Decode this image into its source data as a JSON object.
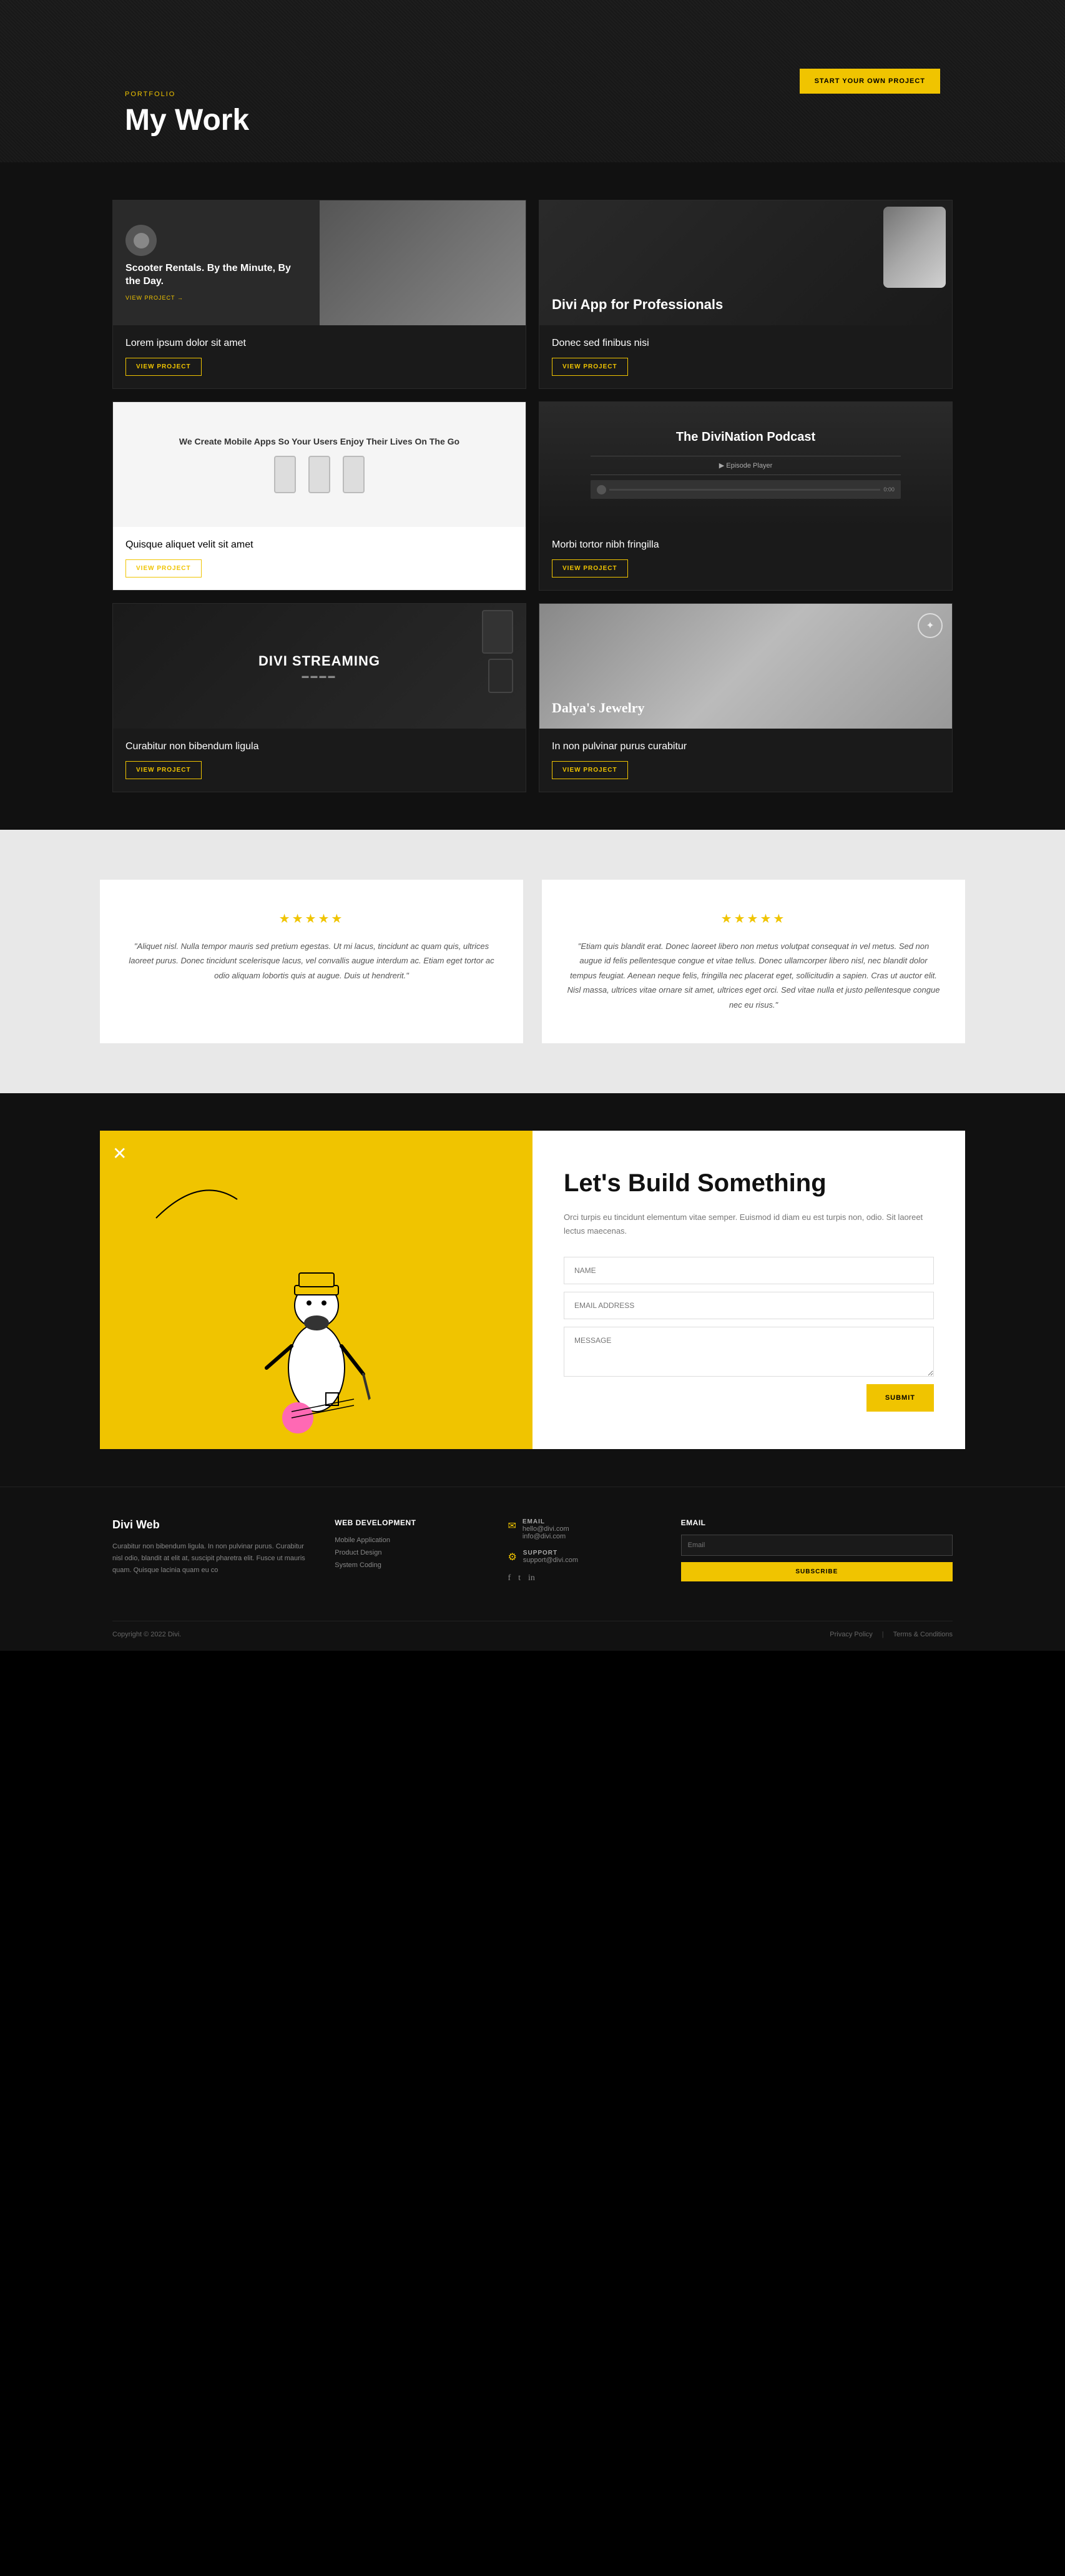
{
  "hero": {
    "label": "PORTFOLIO",
    "title": "My Work",
    "cta_button": "START YOUR OWN PROJECT"
  },
  "projects": [
    {
      "id": "scooter",
      "thumb_title": "Scooter Rentals. By the Minute, By the Day.",
      "description": "Lorem ipsum dolor sit amet",
      "btn_label": "VIEW PROJECT",
      "theme": "dark"
    },
    {
      "id": "divi-app",
      "thumb_title": "Divi App for Professionals",
      "description": "Donec sed finibus nisi",
      "btn_label": "VIEW PROJECT",
      "theme": "dark"
    },
    {
      "id": "mobile",
      "thumb_title": "We Create Mobile Apps So Your Users Enjoy Their Lives On The Go",
      "description": "Quisque aliquet velit sit amet",
      "btn_label": "VIEW PROJECT",
      "theme": "light"
    },
    {
      "id": "divination",
      "thumb_title": "The DiviNation Podcast",
      "description": "Morbi tortor nibh fringilla",
      "btn_label": "VIEW PROJECT",
      "theme": "dark"
    },
    {
      "id": "streaming",
      "thumb_title": "DIVI STREAMING",
      "description": "Curabitur non bibendum ligula",
      "btn_label": "VIEW PROJECT",
      "theme": "dark"
    },
    {
      "id": "jewelry",
      "thumb_title": "Dalya's Jewelry",
      "description": "In non pulvinar purus curabitur",
      "btn_label": "VIEW PROJECT",
      "theme": "dark"
    }
  ],
  "testimonials": [
    {
      "stars": "★★★★★",
      "text": "\"Aliquet nisl. Nulla tempor mauris sed pretium egestas. Ut mi lacus, tincidunt ac quam quis, ultrices laoreet purus. Donec tincidunt scelerisque lacus, vel convallis augue interdum ac. Etiam eget tortor ac odio aliquam lobortis quis at augue. Duis ut hendrerit.\""
    },
    {
      "stars": "★★★★★",
      "text": "\"Etiam quis blandit erat. Donec laoreet libero non metus volutpat consequat in vel metus. Sed non augue id felis pellentesque congue et vitae tellus. Donec ullamcorper libero nisl, nec blandit dolor tempus feugiat. Aenean neque felis, fringilla nec placerat eget, sollicitudin a sapien. Cras ut auctor elit. Nisl massa, ultrices vitae ornare sit amet, ultrices eget orci. Sed vitae nulla et justo pellentesque congue nec eu risus.\""
    }
  ],
  "cta": {
    "title": "Let's Build Something",
    "description": "Orci turpis eu tincidunt elementum vitae semper. Euismod id diam eu est turpis non, odio. Sit laoreet lectus maecenas.",
    "form": {
      "name_placeholder": "NAME",
      "email_placeholder": "EMAIL ADDRESS",
      "message_placeholder": "MESSAGE",
      "submit_label": "SUBMIT"
    },
    "deco_x": "✕"
  },
  "footer": {
    "brand_name": "Divi Web",
    "brand_desc": "Curabitur non bibendum ligula. In non pulvinar purus. Curabitur nisl odio, blandit at elit at, suscipit pharetra elit. Fusce ut mauris quam. Quisque lacinia quam eu co",
    "nav_col": {
      "title": "Web Development",
      "links": [
        "Mobile Application",
        "Product Design",
        "System Coding"
      ]
    },
    "contact": {
      "email_label": "EMAIL",
      "email_values": [
        "hello@divi.com",
        "info@divi.com"
      ],
      "support_label": "SUPPORT",
      "support_value": "support@divi.com"
    },
    "newsletter": {
      "label": "EMAIL",
      "subscribe_label": "SUBSCRIBE"
    },
    "social": [
      "f",
      "t",
      "i"
    ],
    "copyright": "Copyright © 2022 Divi.",
    "legal_links": [
      "Privacy Policy",
      "Terms & Conditions"
    ]
  }
}
